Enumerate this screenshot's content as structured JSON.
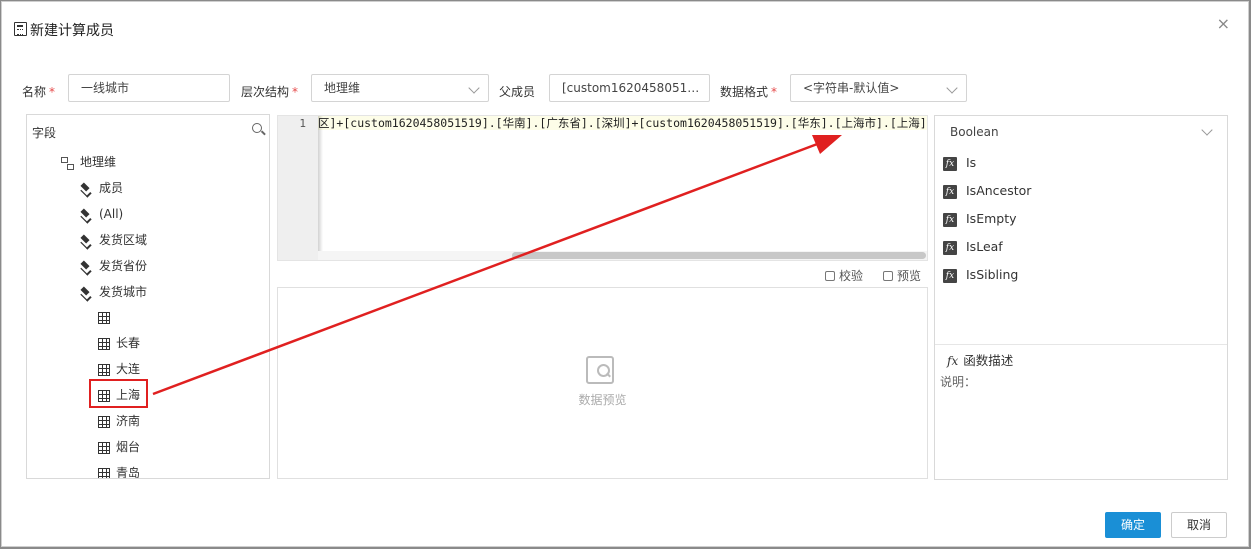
{
  "dialog": {
    "title": "新建计算成员",
    "close": "×"
  },
  "form": {
    "name_label": "名称",
    "name_value": "一线城市",
    "hierarchy_label": "层次结构",
    "hierarchy_value": "地理维",
    "parent_label": "父成员",
    "parent_value": "[custom1620458051…",
    "format_label": "数据格式",
    "format_value": "<字符串-默认值>",
    "required_mark": "*"
  },
  "tree": {
    "header": "字段",
    "root": "地理维",
    "levels": [
      "成员",
      "(All)",
      "发货区域",
      "发货省份",
      "发货城市"
    ],
    "members": [
      "",
      "长春",
      "大连",
      "上海",
      "济南",
      "烟台",
      "青岛"
    ],
    "highlighted_member": "上海"
  },
  "editor": {
    "line_number": "1",
    "code": "区]+[custom1620458051519].[华南].[广东省].[深圳]+[custom1620458051519].[华东].[上海市].[上海]"
  },
  "toolbar": {
    "validate": "校验",
    "preview": "预览"
  },
  "preview": {
    "placeholder": "数据预览"
  },
  "functions": {
    "category": "Boolean",
    "items": [
      "Is",
      "IsAncestor",
      "IsEmpty",
      "IsLeaf",
      "IsSibling"
    ],
    "fx_icon": "fx",
    "desc_title": "函数描述",
    "desc_label": "说明："
  },
  "buttons": {
    "ok": "确定",
    "cancel": "取消"
  },
  "colors": {
    "primary": "#1a8fd6",
    "required": "#e64a4a",
    "annotation": "#e02020"
  }
}
